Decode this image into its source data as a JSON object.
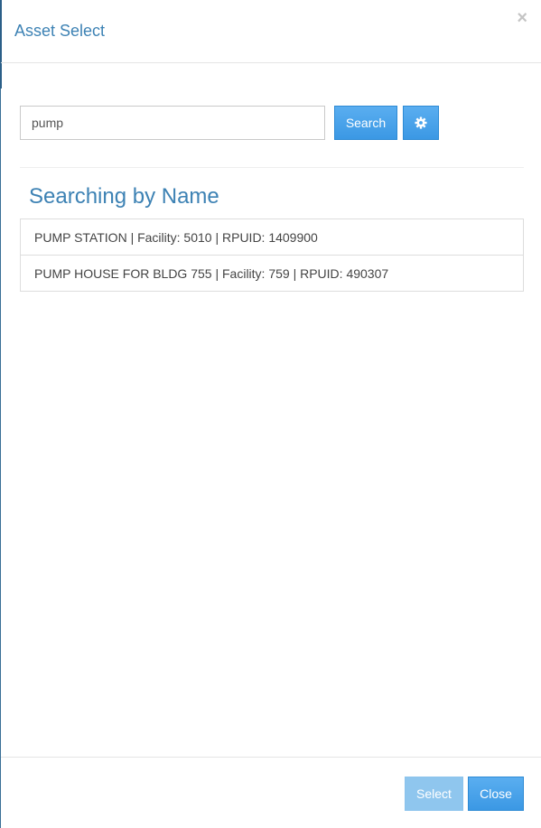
{
  "header": {
    "title": "Asset Select",
    "close_glyph": "×"
  },
  "search": {
    "value": "pump",
    "button_label": "Search",
    "settings_icon": "gear-icon"
  },
  "results": {
    "heading": "Searching by Name",
    "items": [
      "PUMP STATION | Facility: 5010 | RPUID: 1409900",
      "PUMP HOUSE FOR BLDG 755 | Facility: 759 | RPUID: 490307"
    ]
  },
  "footer": {
    "select_label": "Select",
    "close_label": "Close"
  },
  "colors": {
    "title": "#3d82b4",
    "primary_button": "#3b98e4",
    "disabled_button": "#8fc6ee"
  }
}
